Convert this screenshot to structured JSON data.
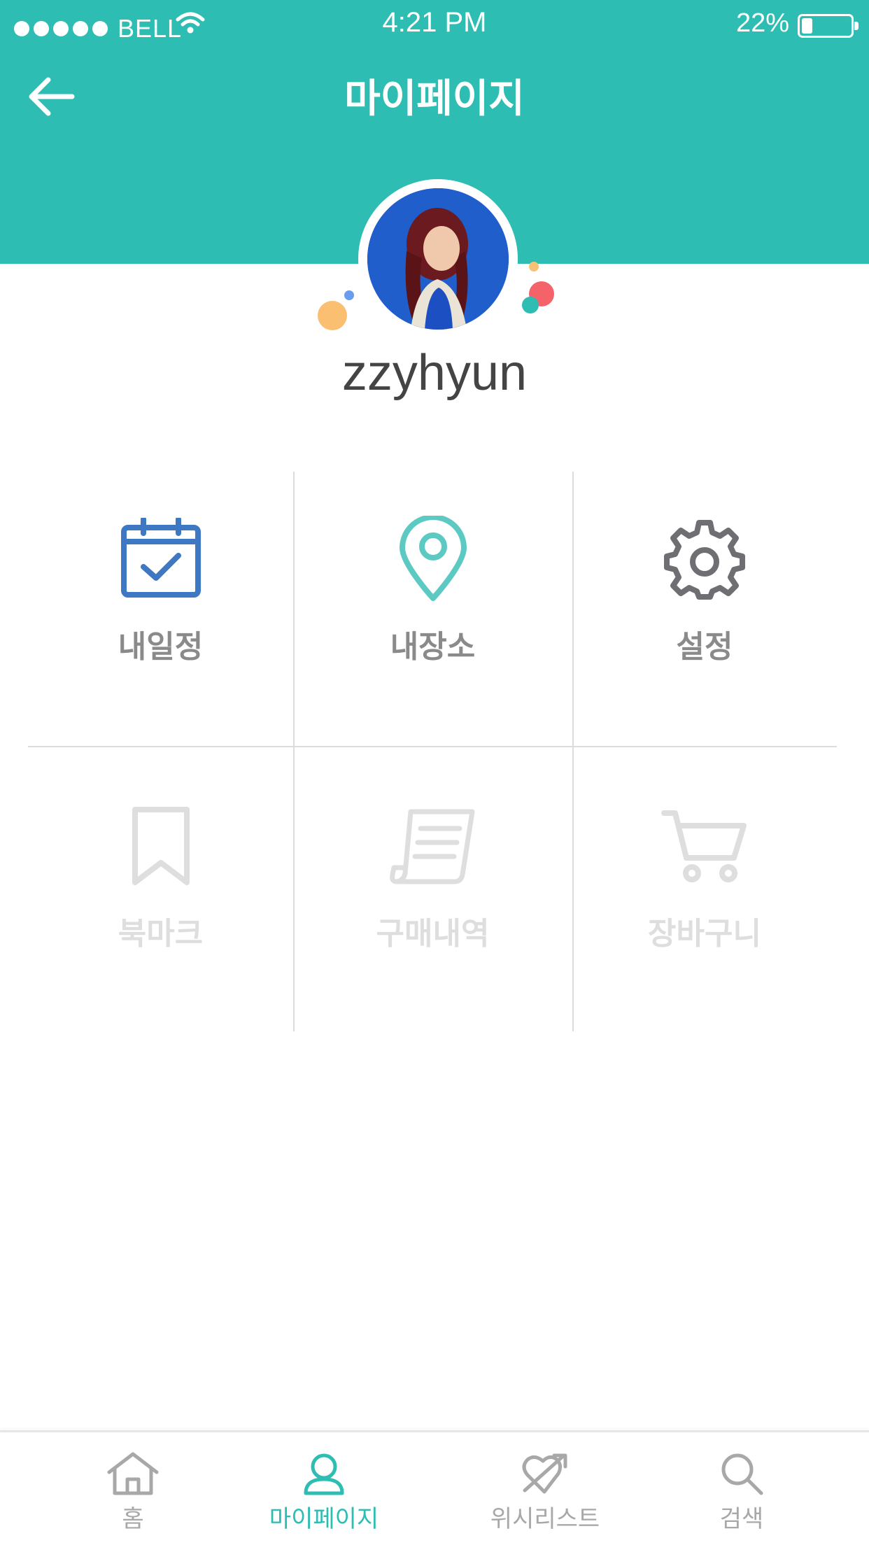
{
  "status_bar": {
    "carrier": "BELL",
    "time": "4:21 PM",
    "battery_percent": "22%",
    "battery_level": 0.22
  },
  "header": {
    "title": "마이페이지",
    "back_icon": "arrow-left-icon",
    "background_color": "#2dbdb2"
  },
  "profile": {
    "username": "zzyhyun"
  },
  "menu": {
    "items": [
      {
        "label": "내일정",
        "icon": "calendar-check-icon",
        "color": "#3f78c2",
        "enabled": true
      },
      {
        "label": "내장소",
        "icon": "map-pin-icon",
        "color": "#5cc9c3",
        "enabled": true
      },
      {
        "label": "설정",
        "icon": "gear-icon",
        "color": "#6e6e73",
        "enabled": true
      },
      {
        "label": "북마크",
        "icon": "bookmark-icon",
        "color": "#dedede",
        "enabled": false
      },
      {
        "label": "구매내역",
        "icon": "receipt-icon",
        "color": "#dedede",
        "enabled": false
      },
      {
        "label": "장바구니",
        "icon": "cart-icon",
        "color": "#dedede",
        "enabled": false
      }
    ]
  },
  "tab_bar": {
    "active_color": "#2dbdb2",
    "inactive_color": "#a8a8a8",
    "tabs": [
      {
        "label": "홈",
        "icon": "home-icon",
        "active": false
      },
      {
        "label": "마이페이지",
        "icon": "user-icon",
        "active": true
      },
      {
        "label": "위시리스트",
        "icon": "heart-arrow-icon",
        "active": false
      },
      {
        "label": "검색",
        "icon": "search-icon",
        "active": false
      }
    ]
  }
}
